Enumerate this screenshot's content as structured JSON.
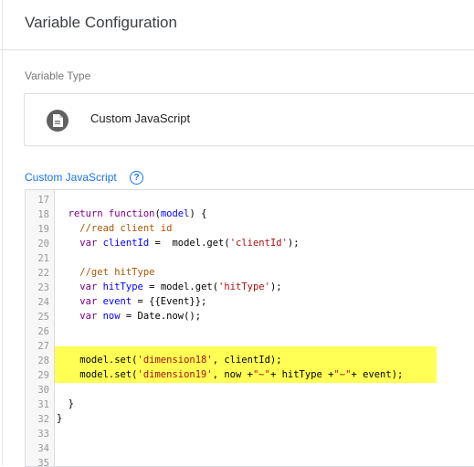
{
  "header": {
    "title": "Variable Configuration"
  },
  "variable_type": {
    "label": "Variable Type",
    "name": "Custom JavaScript",
    "icon": "document-icon"
  },
  "code_section": {
    "label": "Custom JavaScript",
    "help_icon": "help-circle-icon",
    "line_numbers": [
      "17",
      "18",
      "19",
      "20",
      "21",
      "22",
      "23",
      "24",
      "25",
      "26",
      "27",
      "28",
      "29",
      "30",
      "31",
      "32",
      "33",
      "34",
      "35"
    ],
    "lines": [
      "",
      "  return function(model) {",
      "    //read client id",
      "    var clientId =  model.get('clientId');",
      "",
      "    //get hitType",
      "    var hitType = model.get('hitType');",
      "    var event = {{Event}};",
      "    var now = Date.now();",
      "",
      "",
      "    model.set('dimension18', clientId);",
      "    model.set('dimension19', now +\"~\"+ hitType +\"~\"+ event);",
      "",
      "  }",
      "}",
      "",
      "",
      ""
    ],
    "highlight_color": "#ffff54"
  }
}
